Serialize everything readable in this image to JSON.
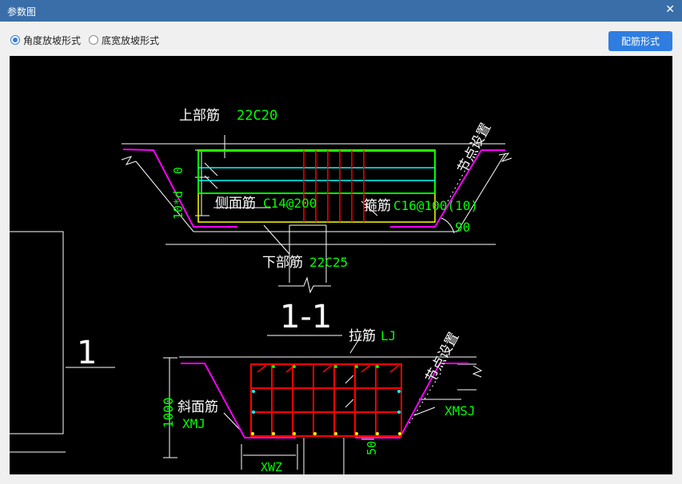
{
  "window": {
    "title": "参数图",
    "close_icon": "close-icon"
  },
  "toolbar": {
    "radio_angle": {
      "label": "角度放坡形式",
      "checked": true
    },
    "radio_width": {
      "label": "底宽放坡形式",
      "checked": false
    },
    "config_button": "配筋形式"
  },
  "colors": {
    "titlebar": "#3a6ea8",
    "accent": "#2f7de0",
    "green": "#00ff00",
    "red": "#ff0000",
    "magenta": "#ff00ff",
    "cyan": "#00ffff",
    "yellow": "#ffff00"
  },
  "drawing": {
    "upper": {
      "top_bar_label": "上部筋",
      "top_bar_value": "22C20",
      "dim_top": "0",
      "dim_side": "10*d",
      "side_bar_label": "侧面筋",
      "side_bar_value": "C14@200",
      "stirrup_label": "箍筋",
      "stirrup_value": "C16@100(10)",
      "bottom_bar_label": "下部筋",
      "bottom_bar_value": "22C25",
      "angle": "90",
      "node_setting": "节点设置"
    },
    "section_title": "1-1",
    "left_marker": "1",
    "lower": {
      "tie_label": "拉筋",
      "tie_value": "LJ",
      "node_setting": "节点设置",
      "slope_label": "斜面筋",
      "slope_value": "XMJ",
      "xmsj": "XMSJ",
      "height": "1000",
      "dim_50": "50",
      "xwz": "XWZ"
    }
  }
}
